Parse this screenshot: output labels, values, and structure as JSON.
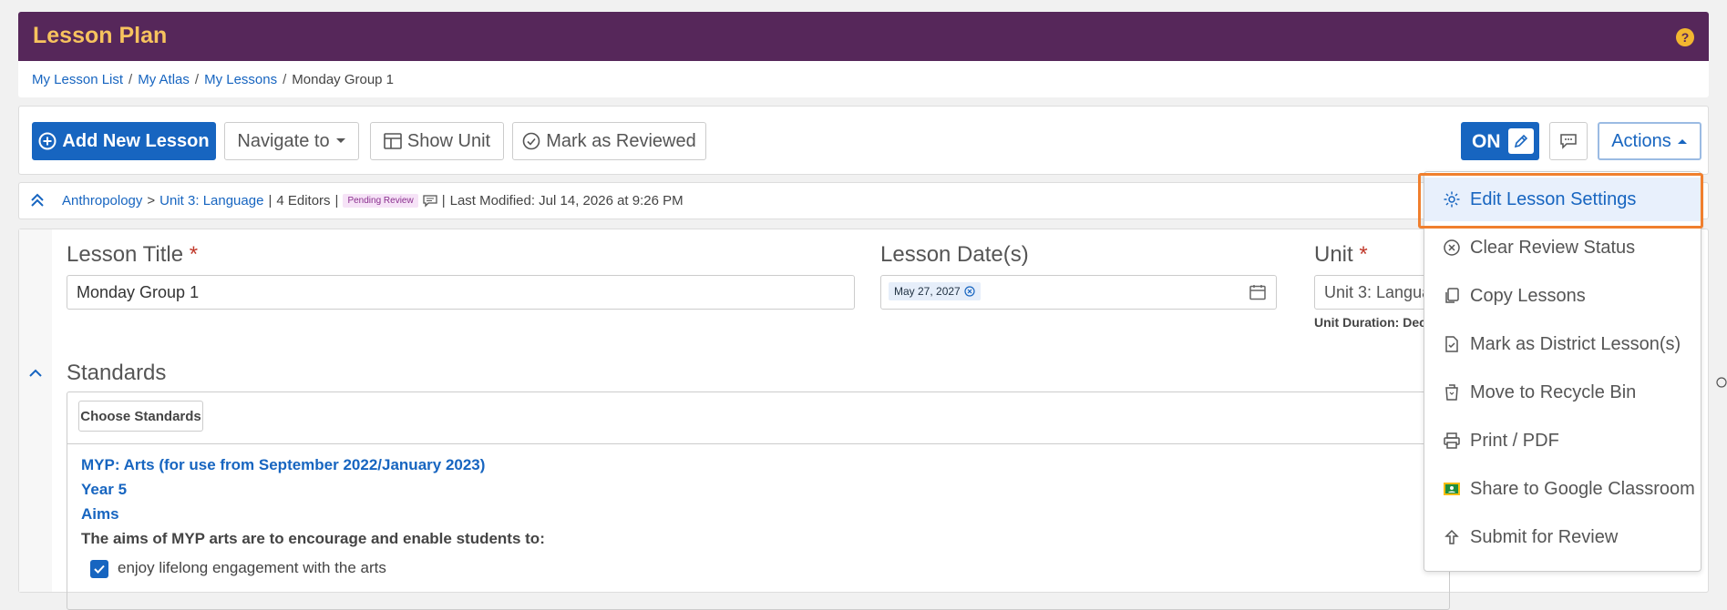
{
  "header": {
    "title": "Lesson Plan",
    "help": "?"
  },
  "breadcrumb": [
    "My Lesson List",
    "My Atlas",
    "My Lessons",
    "Monday Group 1"
  ],
  "breadcrumb_sep": "/",
  "toolbar": {
    "add_new_lesson": "Add New Lesson",
    "navigate_to": "Navigate to",
    "show_unit": "Show Unit",
    "mark_as_reviewed": "Mark as Reviewed",
    "toggle": "ON",
    "actions": "Actions"
  },
  "meta": {
    "course": "Anthropology",
    "arrow": ">",
    "unit": "Unit 3: Language",
    "divider": "|",
    "editors": "4 Editors",
    "status": "Pending Review",
    "last_modified": "Last Modified: Jul 14, 2026 at 9:26 PM"
  },
  "fields": {
    "lesson_title_label": "Lesson Title",
    "required_mark": "*",
    "lesson_title_value": "Monday Group 1",
    "lesson_dates_label": "Lesson Date(s)",
    "lesson_date_chip": "May 27, 2027",
    "unit_label": "Unit",
    "unit_value": "Unit 3: Langua",
    "unit_duration": "Unit Duration: Dec"
  },
  "standards": {
    "label": "Standards",
    "choose": "Choose Standards",
    "framework": "MYP: Arts (for use from September 2022/January 2023)",
    "year": "Year 5",
    "section": "Aims",
    "intro": "The aims of MYP arts are to encourage and enable students to:",
    "item": "enjoy lifelong engagement with the arts"
  },
  "actions_menu": [
    {
      "label": "Edit Lesson Settings",
      "icon": "gear-icon",
      "active": true
    },
    {
      "label": "Clear Review Status",
      "icon": "x-circle-icon"
    },
    {
      "label": "Copy Lessons",
      "icon": "copy-icon"
    },
    {
      "label": "Mark as District Lesson(s)",
      "icon": "file-check-icon"
    },
    {
      "label": "Move to Recycle Bin",
      "icon": "recycle-bin-icon"
    },
    {
      "label": "Print / PDF",
      "icon": "printer-icon"
    },
    {
      "label": "Share to Google Classroom",
      "icon": "google-classroom-icon"
    },
    {
      "label": "Submit for Review",
      "icon": "upload-icon"
    }
  ],
  "colors": {
    "header_bg": "#56275a",
    "header_title": "#f7c35e",
    "primary": "#1765c0",
    "highlight": "#f07f2e"
  }
}
